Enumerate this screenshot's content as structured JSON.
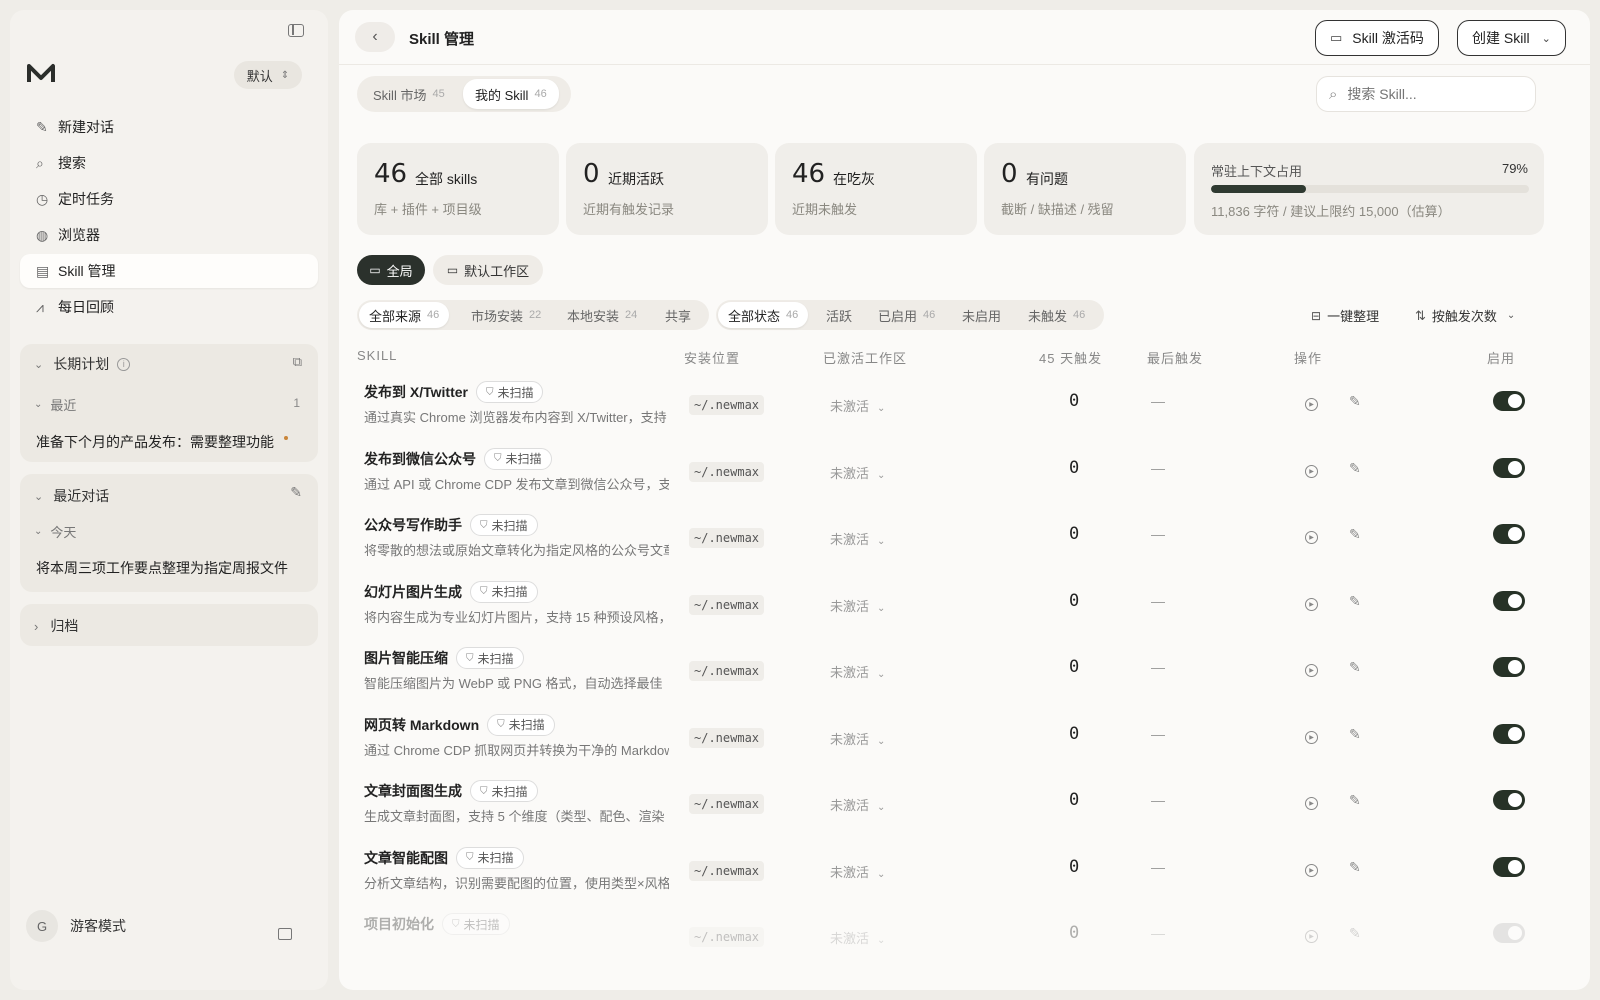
{
  "sidebar": {
    "workspace_label": "默认",
    "nav": [
      {
        "label": "新建对话",
        "icon": "edit-icon"
      },
      {
        "label": "搜索",
        "icon": "search-icon"
      },
      {
        "label": "定时任务",
        "icon": "clock-icon"
      },
      {
        "label": "浏览器",
        "icon": "globe-icon"
      },
      {
        "label": "Skill 管理",
        "icon": "scroll-icon"
      },
      {
        "label": "每日回顾",
        "icon": "chart-icon"
      }
    ],
    "long_plan": {
      "title": "长期计划",
      "group": "最近",
      "group_count": "1",
      "item": "准备下个月的产品发布：需要整理功能"
    },
    "recent": {
      "title": "最近对话",
      "group": "今天",
      "item": "将本周三项工作要点整理为指定周报文件"
    },
    "archive": {
      "title": "归档"
    },
    "user": {
      "avatar": "G",
      "label": "游客模式"
    }
  },
  "header": {
    "title": "Skill 管理",
    "activate_button": "Skill 激活码",
    "create_button": "创建 Skill"
  },
  "tabs": [
    {
      "label": "Skill 市场",
      "count": "45"
    },
    {
      "label": "我的 Skill",
      "count": "46"
    }
  ],
  "search": {
    "placeholder": "搜索 Skill..."
  },
  "stats": [
    {
      "num": "46",
      "label": "全部 skills",
      "sub": "库 + 插件 + 项目级"
    },
    {
      "num": "0",
      "label": "近期活跃",
      "sub": "近期有触发记录"
    },
    {
      "num": "46",
      "label": "在吃灰",
      "sub": "近期未触发"
    },
    {
      "num": "0",
      "label": "有问题",
      "sub": "截断 / 缺描述 / 残留"
    }
  ],
  "context": {
    "label": "常驻上下文占用",
    "percent": "79%",
    "fill": 0.79,
    "sub": "11,836 字符 / 建议上限约 15,000（估算）"
  },
  "scope": {
    "all": "全局",
    "workspace": "默认工作区"
  },
  "source_filters": [
    {
      "label": "全部来源",
      "count": "46"
    },
    {
      "label": "市场安装",
      "count": "22"
    },
    {
      "label": "本地安装",
      "count": "24"
    },
    {
      "label": "共享",
      "count": ""
    }
  ],
  "status_filters": [
    {
      "label": "全部状态",
      "count": "46"
    },
    {
      "label": "活跃",
      "count": ""
    },
    {
      "label": "已启用",
      "count": "46"
    },
    {
      "label": "未启用",
      "count": ""
    },
    {
      "label": "未触发",
      "count": "46"
    }
  ],
  "actions": {
    "organize": "一键整理",
    "sort": "按触发次数"
  },
  "columns": [
    "SKILL",
    "安装位置",
    "已激活工作区",
    "45 天触发",
    "最后触发",
    "操作",
    "启用"
  ],
  "rows": [
    {
      "name": "发布到 X/Twitter",
      "badge": "未扫描",
      "desc": "通过真实 Chrome 浏览器发布内容到 X/Twitter，支持",
      "loc": "~/.newmax",
      "ws": "未激活",
      "trig": "0",
      "last": "—"
    },
    {
      "name": "发布到微信公众号",
      "badge": "未扫描",
      "desc": "通过 API 或 Chrome CDP 发布文章到微信公众号，支",
      "loc": "~/.newmax",
      "ws": "未激活",
      "trig": "0",
      "last": "—"
    },
    {
      "name": "公众号写作助手",
      "badge": "未扫描",
      "desc": "将零散的想法或原始文章转化为指定风格的公众号文章",
      "loc": "~/.newmax",
      "ws": "未激活",
      "trig": "0",
      "last": "—"
    },
    {
      "name": "幻灯片图片生成",
      "badge": "未扫描",
      "desc": "将内容生成为专业幻灯片图片，支持 15 种预设风格，",
      "loc": "~/.newmax",
      "ws": "未激活",
      "trig": "0",
      "last": "—"
    },
    {
      "name": "图片智能压缩",
      "badge": "未扫描",
      "desc": "智能压缩图片为 WebP 或 PNG 格式，自动选择最佳",
      "loc": "~/.newmax",
      "ws": "未激活",
      "trig": "0",
      "last": "—"
    },
    {
      "name": "网页转 Markdown",
      "badge": "未扫描",
      "desc": "通过 Chrome CDP 抓取网页并转换为干净的 Markdown",
      "loc": "~/.newmax",
      "ws": "未激活",
      "trig": "0",
      "last": "—"
    },
    {
      "name": "文章封面图生成",
      "badge": "未扫描",
      "desc": "生成文章封面图，支持 5 个维度（类型、配色、渲染",
      "loc": "~/.newmax",
      "ws": "未激活",
      "trig": "0",
      "last": "—"
    },
    {
      "name": "文章智能配图",
      "badge": "未扫描",
      "desc": "分析文章结构，识别需要配图的位置，使用类型×风格",
      "loc": "~/.newmax",
      "ws": "未激活",
      "trig": "0",
      "last": "—"
    },
    {
      "name": "项目初始化",
      "badge": "未扫描",
      "desc": "",
      "loc": "~/.newmax",
      "ws": "未激活",
      "trig": "0",
      "last": "—"
    }
  ]
}
